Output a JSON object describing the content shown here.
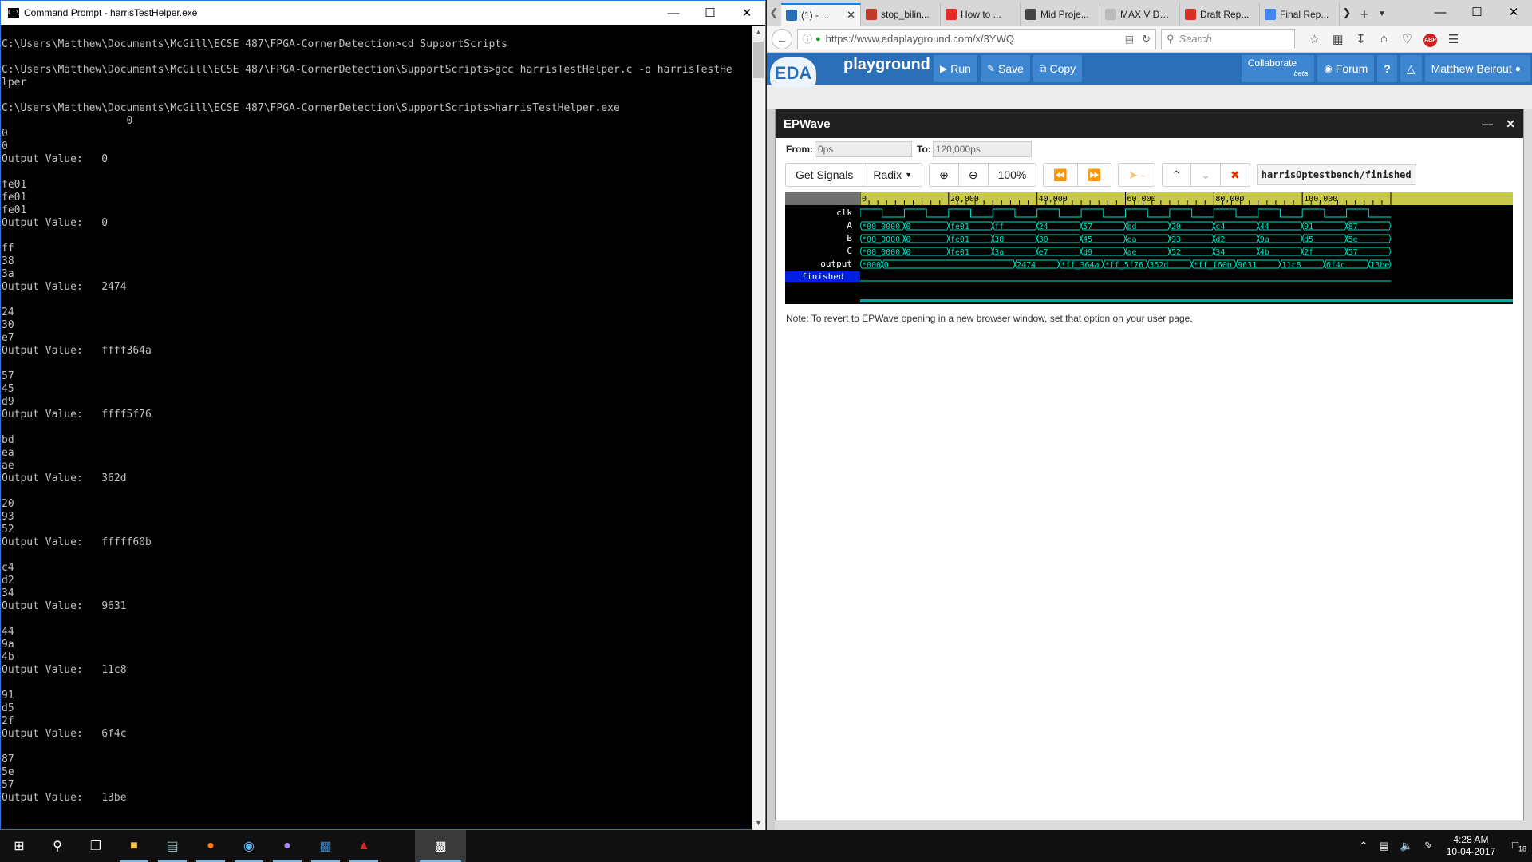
{
  "cmd": {
    "title": "Command Prompt - harrisTestHelper.exe",
    "lines": [
      "C:\\Users\\Matthew\\Documents\\McGill\\ECSE 487\\FPGA-CornerDetection>cd SupportScripts",
      "",
      "C:\\Users\\Matthew\\Documents\\McGill\\ECSE 487\\FPGA-CornerDetection\\SupportScripts>gcc harrisTestHelper.c -o harrisTestHe",
      "lper",
      "",
      "C:\\Users\\Matthew\\Documents\\McGill\\ECSE 487\\FPGA-CornerDetection\\SupportScripts>harrisTestHelper.exe",
      "                    0",
      "0",
      "0",
      "Output Value:   0",
      "",
      "fe01",
      "fe01",
      "fe01",
      "Output Value:   0",
      "",
      "ff",
      "38",
      "3a",
      "Output Value:   2474",
      "",
      "24",
      "30",
      "e7",
      "Output Value:   ffff364a",
      "",
      "57",
      "45",
      "d9",
      "Output Value:   ffff5f76",
      "",
      "bd",
      "ea",
      "ae",
      "Output Value:   362d",
      "",
      "20",
      "93",
      "52",
      "Output Value:   fffff60b",
      "",
      "c4",
      "d2",
      "34",
      "Output Value:   9631",
      "",
      "44",
      "9a",
      "4b",
      "Output Value:   11c8",
      "",
      "91",
      "d5",
      "2f",
      "Output Value:   6f4c",
      "",
      "87",
      "5e",
      "57",
      "Output Value:   13be"
    ]
  },
  "browser": {
    "tabs": [
      {
        "label": "(1) - ...",
        "icon": "eda-icon",
        "color": "#2a6fb7",
        "active": true
      },
      {
        "label": "stop_bilin...",
        "icon": "bird-icon",
        "color": "#c0392b",
        "active": false
      },
      {
        "label": "How to ...",
        "icon": "youtube-icon",
        "color": "#e52d27",
        "active": false
      },
      {
        "label": "Mid Proje...",
        "icon": "github-icon",
        "color": "#444444",
        "active": false
      },
      {
        "label": "MAX V Devic...",
        "icon": "page-icon",
        "color": "#bbbbbb",
        "active": false
      },
      {
        "label": "Draft Rep...",
        "icon": "gmail-icon",
        "color": "#d93025",
        "active": false
      },
      {
        "label": "Final Rep...",
        "icon": "docs-icon",
        "color": "#4285f4",
        "active": false
      }
    ],
    "url": "https://www.edaplayground.com/x/3YWQ",
    "search_placeholder": "Search"
  },
  "eda": {
    "logo_word": "playground",
    "logo_badge": "EDA",
    "buttons": {
      "run": "Run",
      "save": "Save",
      "copy": "Copy",
      "collaborate": "Collaborate",
      "collaborate_tag": "beta",
      "forum": "Forum",
      "help": "?",
      "user": "Matthew Beirout"
    }
  },
  "epwave": {
    "title": "EPWave",
    "from_label": "From:",
    "from_value": "0ps",
    "to_label": "To:",
    "to_value": "120,000ps",
    "get_signals": "Get Signals",
    "radix": "Radix",
    "zoom_level": "100%",
    "signal_path": "harrisOptestbench/finished",
    "note": "Note: To revert to EPWave opening in a new browser window, set that option on your user page.",
    "time_labels": [
      "0",
      "20,000",
      "40,000",
      "60,000",
      "80,000",
      "100,000"
    ],
    "signals": [
      {
        "name": "clk",
        "type": "clock"
      },
      {
        "name": "A",
        "type": "bus",
        "values": [
          "*00_0000",
          "0",
          "fe01",
          "ff",
          "24",
          "57",
          "bd",
          "20",
          "c4",
          "44",
          "91",
          "87"
        ]
      },
      {
        "name": "B",
        "type": "bus",
        "values": [
          "*00_0000",
          "0",
          "fe01",
          "38",
          "30",
          "45",
          "ea",
          "93",
          "d2",
          "9a",
          "d5",
          "5e"
        ]
      },
      {
        "name": "C",
        "type": "bus",
        "values": [
          "*00_0000",
          "0",
          "fe01",
          "3a",
          "e7",
          "d9",
          "ae",
          "52",
          "34",
          "4b",
          "2f",
          "57"
        ]
      },
      {
        "name": "output",
        "type": "bus_output",
        "values": [
          "*000",
          "0",
          "2474",
          "*ff_364a",
          "*ff_5f76",
          "362d",
          "*ff_f60b",
          "9631",
          "11c8",
          "6f4c",
          "13be"
        ]
      },
      {
        "name": "finished",
        "type": "flat"
      }
    ]
  },
  "taskbar": {
    "time": "4:28 AM",
    "date": "10-04-2017",
    "notifications": "18"
  }
}
